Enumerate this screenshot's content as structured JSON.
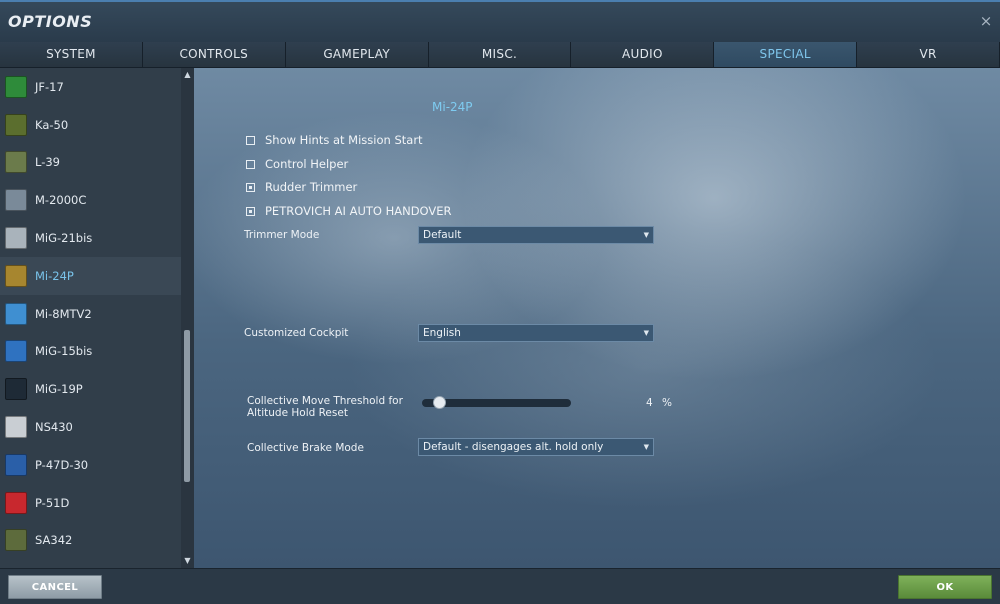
{
  "window": {
    "title": "OPTIONS",
    "close_glyph": "×"
  },
  "tabs": [
    {
      "label": "SYSTEM"
    },
    {
      "label": "CONTROLS"
    },
    {
      "label": "GAMEPLAY"
    },
    {
      "label": "MISC."
    },
    {
      "label": "AUDIO"
    },
    {
      "label": "SPECIAL"
    },
    {
      "label": "VR"
    }
  ],
  "sidebar": {
    "items": [
      {
        "label": "JF-17",
        "icon": "jf17-icon",
        "color": "#2e8b3a"
      },
      {
        "label": "Ka-50",
        "icon": "ka50-icon",
        "color": "#5b6e2e"
      },
      {
        "label": "L-39",
        "icon": "l39-icon",
        "color": "#6b7b4b"
      },
      {
        "label": "M-2000C",
        "icon": "m2000c-icon",
        "color": "#7a8a99"
      },
      {
        "label": "MiG-21bis",
        "icon": "mig21bis-icon",
        "color": "#a9b3bb"
      },
      {
        "label": "Mi-24P",
        "icon": "mi24p-icon",
        "color": "#a7862f"
      },
      {
        "label": "Mi-8MTV2",
        "icon": "mi8mtv2-icon",
        "color": "#3f8fd1"
      },
      {
        "label": "MiG-15bis",
        "icon": "mig15bis-icon",
        "color": "#2f72c0"
      },
      {
        "label": "MiG-19P",
        "icon": "mig19p-icon",
        "color": "#1e2a36"
      },
      {
        "label": "NS430",
        "icon": "ns430-icon",
        "color": "#c9ced3"
      },
      {
        "label": "P-47D-30",
        "icon": "p47d30-icon",
        "color": "#2a5fa8"
      },
      {
        "label": "P-51D",
        "icon": "p51d-icon",
        "color": "#c8282e"
      },
      {
        "label": "SA342",
        "icon": "sa342-icon",
        "color": "#5d6b3c"
      }
    ],
    "selected_label": "Mi-24P",
    "scroll_up_glyph": "▲",
    "scroll_down_glyph": "▼"
  },
  "main": {
    "aircraft_title": "Mi-24P",
    "checkboxes": [
      {
        "label": "Show Hints at Mission Start",
        "checked": false
      },
      {
        "label": "Control Helper",
        "checked": false
      },
      {
        "label": "Rudder Trimmer",
        "checked": true
      },
      {
        "label": "PETROVICH AI AUTO HANDOVER",
        "checked": true
      }
    ],
    "trimmer_mode": {
      "label": "Trimmer Mode",
      "value": "Default"
    },
    "customized_cockpit": {
      "label": "Customized Cockpit",
      "value": "English"
    },
    "collective_threshold": {
      "label_line1": "Collective Move Threshold for",
      "label_line2": "Altitude Hold Reset",
      "value": "4",
      "unit": "%",
      "fraction": 0.04
    },
    "collective_brake": {
      "label": "Collective Brake Mode",
      "value": "Default - disengages alt. hold only"
    },
    "dropdown_glyph": "▼"
  },
  "footer": {
    "cancel_label": "CANCEL",
    "ok_label": "OK"
  }
}
